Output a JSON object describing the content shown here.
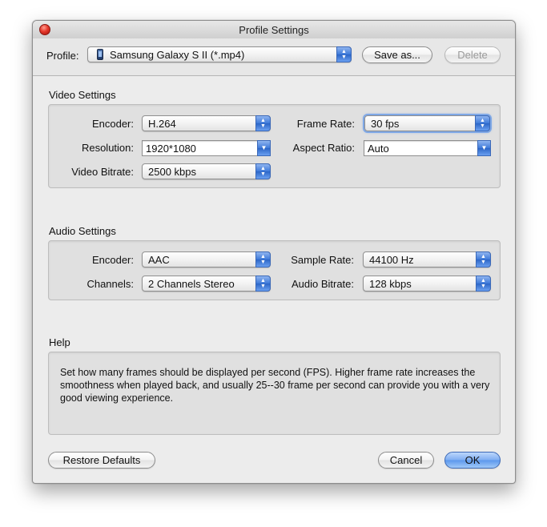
{
  "window": {
    "title": "Profile Settings"
  },
  "toolbar": {
    "profile_label": "Profile:",
    "profile_value": "Samsung Galaxy S II (*.mp4)",
    "profile_icon": "phone-icon",
    "save_as_label": "Save as...",
    "delete_label": "Delete"
  },
  "video": {
    "title": "Video Settings",
    "encoder_label": "Encoder:",
    "encoder_value": "H.264",
    "resolution_label": "Resolution:",
    "resolution_value": "1920*1080",
    "bitrate_label": "Video Bitrate:",
    "bitrate_value": "2500 kbps",
    "framerate_label": "Frame Rate:",
    "framerate_value": "30 fps",
    "aspect_label": "Aspect Ratio:",
    "aspect_value": "Auto"
  },
  "audio": {
    "title": "Audio Settings",
    "encoder_label": "Encoder:",
    "encoder_value": "AAC",
    "channels_label": "Channels:",
    "channels_value": "2 Channels Stereo",
    "samplerate_label": "Sample Rate:",
    "samplerate_value": "44100 Hz",
    "bitrate_label": "Audio Bitrate:",
    "bitrate_value": "128 kbps"
  },
  "help": {
    "title": "Help",
    "text": "Set how many frames should be displayed per second (FPS). Higher frame rate increases the smoothness when played back, and usually 25--30 frame per second can provide you with a very good viewing experience."
  },
  "footer": {
    "restore_label": "Restore Defaults",
    "cancel_label": "Cancel",
    "ok_label": "OK"
  },
  "colors": {
    "accent": "#5b97ec",
    "close": "#e5382b"
  }
}
